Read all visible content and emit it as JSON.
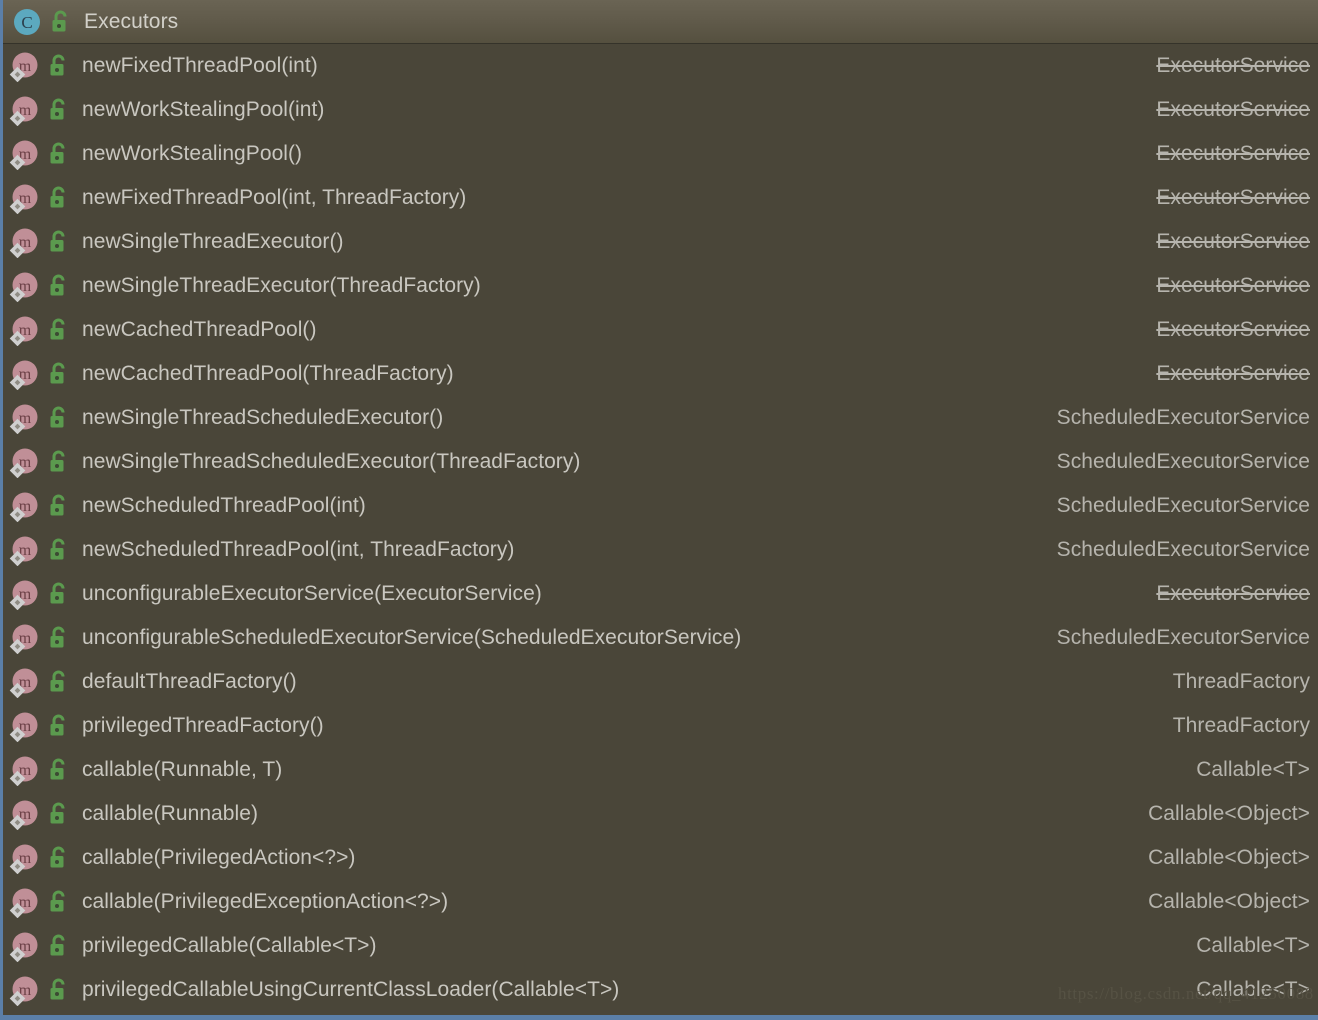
{
  "panel": {
    "name": "structure-view",
    "header": {
      "class_icon": "class-icon",
      "visibility_icon": "public-unlocked-icon",
      "title": "Executors"
    },
    "colors": {
      "background": "#4a4639",
      "header_gradient_top": "#6a6454",
      "header_gradient_bottom": "#55503f",
      "text": "#c9c7c0",
      "return_type_text": "#b6b4ad",
      "class_icon_fill": "#5ca9bf",
      "method_icon_fill": "#c08f97",
      "lock_icon_fill": "#5b9a4e",
      "selection_border": "#5b7fa8"
    }
  },
  "members": [
    {
      "method_icon": "method-icon",
      "visibility_icon": "public-unlocked-icon",
      "signature": "newFixedThreadPool(int)",
      "return_type": "ExecutorService",
      "deprecated": true
    },
    {
      "method_icon": "method-icon",
      "visibility_icon": "public-unlocked-icon",
      "signature": "newWorkStealingPool(int)",
      "return_type": "ExecutorService",
      "deprecated": true
    },
    {
      "method_icon": "method-icon",
      "visibility_icon": "public-unlocked-icon",
      "signature": "newWorkStealingPool()",
      "return_type": "ExecutorService",
      "deprecated": true
    },
    {
      "method_icon": "method-icon",
      "visibility_icon": "public-unlocked-icon",
      "signature": "newFixedThreadPool(int, ThreadFactory)",
      "return_type": "ExecutorService",
      "deprecated": true
    },
    {
      "method_icon": "method-icon",
      "visibility_icon": "public-unlocked-icon",
      "signature": "newSingleThreadExecutor()",
      "return_type": "ExecutorService",
      "deprecated": true
    },
    {
      "method_icon": "method-icon",
      "visibility_icon": "public-unlocked-icon",
      "signature": "newSingleThreadExecutor(ThreadFactory)",
      "return_type": "ExecutorService",
      "deprecated": true
    },
    {
      "method_icon": "method-icon",
      "visibility_icon": "public-unlocked-icon",
      "signature": "newCachedThreadPool()",
      "return_type": "ExecutorService",
      "deprecated": true
    },
    {
      "method_icon": "method-icon",
      "visibility_icon": "public-unlocked-icon",
      "signature": "newCachedThreadPool(ThreadFactory)",
      "return_type": "ExecutorService",
      "deprecated": true
    },
    {
      "method_icon": "method-icon",
      "visibility_icon": "public-unlocked-icon",
      "signature": "newSingleThreadScheduledExecutor()",
      "return_type": "ScheduledExecutorService",
      "deprecated": false
    },
    {
      "method_icon": "method-icon",
      "visibility_icon": "public-unlocked-icon",
      "signature": "newSingleThreadScheduledExecutor(ThreadFactory)",
      "return_type": "ScheduledExecutorService",
      "deprecated": false
    },
    {
      "method_icon": "method-icon",
      "visibility_icon": "public-unlocked-icon",
      "signature": "newScheduledThreadPool(int)",
      "return_type": "ScheduledExecutorService",
      "deprecated": false
    },
    {
      "method_icon": "method-icon",
      "visibility_icon": "public-unlocked-icon",
      "signature": "newScheduledThreadPool(int, ThreadFactory)",
      "return_type": "ScheduledExecutorService",
      "deprecated": false
    },
    {
      "method_icon": "method-icon",
      "visibility_icon": "public-unlocked-icon",
      "signature": "unconfigurableExecutorService(ExecutorService)",
      "return_type": "ExecutorService",
      "deprecated": true
    },
    {
      "method_icon": "method-icon",
      "visibility_icon": "public-unlocked-icon",
      "signature": "unconfigurableScheduledExecutorService(ScheduledExecutorService)",
      "return_type": "ScheduledExecutorService",
      "deprecated": false
    },
    {
      "method_icon": "method-icon",
      "visibility_icon": "public-unlocked-icon",
      "signature": "defaultThreadFactory()",
      "return_type": "ThreadFactory",
      "deprecated": false
    },
    {
      "method_icon": "method-icon",
      "visibility_icon": "public-unlocked-icon",
      "signature": "privilegedThreadFactory()",
      "return_type": "ThreadFactory",
      "deprecated": false
    },
    {
      "method_icon": "method-icon",
      "visibility_icon": "public-unlocked-icon",
      "signature": "callable(Runnable, T)",
      "return_type": "Callable<T>",
      "deprecated": false
    },
    {
      "method_icon": "method-icon",
      "visibility_icon": "public-unlocked-icon",
      "signature": "callable(Runnable)",
      "return_type": "Callable<Object>",
      "deprecated": false
    },
    {
      "method_icon": "method-icon",
      "visibility_icon": "public-unlocked-icon",
      "signature": "callable(PrivilegedAction<?>)",
      "return_type": "Callable<Object>",
      "deprecated": false
    },
    {
      "method_icon": "method-icon",
      "visibility_icon": "public-unlocked-icon",
      "signature": "callable(PrivilegedExceptionAction<?>)",
      "return_type": "Callable<Object>",
      "deprecated": false
    },
    {
      "method_icon": "method-icon",
      "visibility_icon": "public-unlocked-icon",
      "signature": "privilegedCallable(Callable<T>)",
      "return_type": "Callable<T>",
      "deprecated": false
    },
    {
      "method_icon": "method-icon",
      "visibility_icon": "public-unlocked-icon",
      "signature": "privilegedCallableUsingCurrentClassLoader(Callable<T>)",
      "return_type": "Callable<T>",
      "deprecated": false
    }
  ],
  "watermark": {
    "text": "https://blog.csdn.net/qq_41250088"
  }
}
